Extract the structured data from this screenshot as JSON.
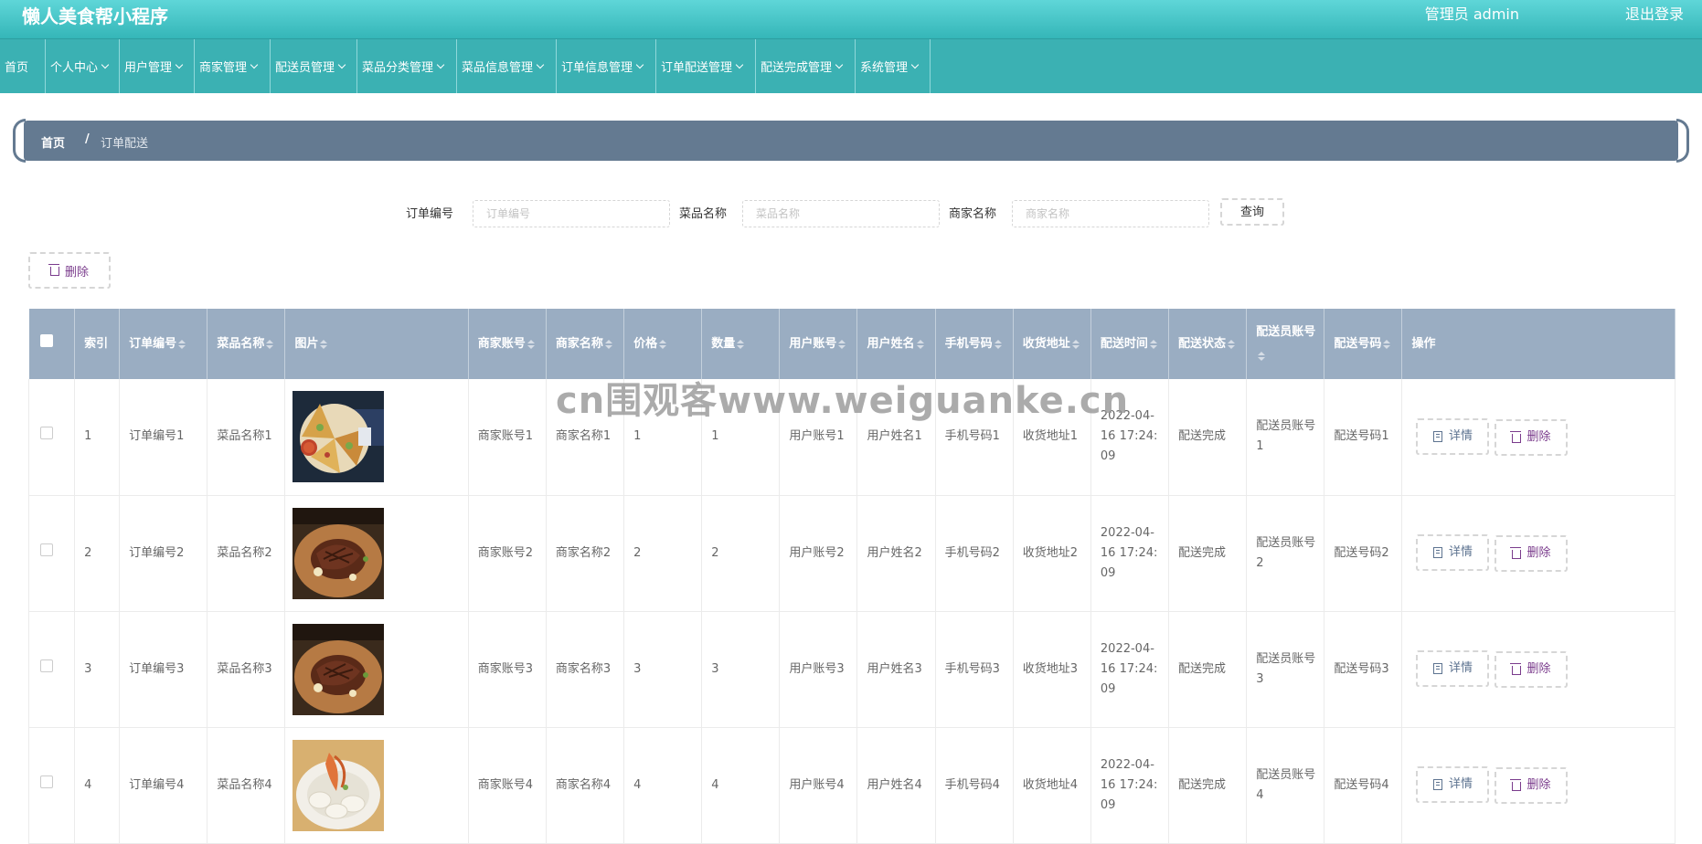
{
  "header": {
    "title": "懒人美食帮小程序",
    "admin": "管理员 admin",
    "logout": "退出登录"
  },
  "nav": [
    {
      "label": "首页",
      "dropdown": false
    },
    {
      "label": "个人中心",
      "dropdown": true
    },
    {
      "label": "用户管理",
      "dropdown": true
    },
    {
      "label": "商家管理",
      "dropdown": true
    },
    {
      "label": "配送员管理",
      "dropdown": true
    },
    {
      "label": "菜品分类管理",
      "dropdown": true
    },
    {
      "label": "菜品信息管理",
      "dropdown": true
    },
    {
      "label": "订单信息管理",
      "dropdown": true
    },
    {
      "label": "订单配送管理",
      "dropdown": true
    },
    {
      "label": "配送完成管理",
      "dropdown": true
    },
    {
      "label": "系统管理",
      "dropdown": true
    }
  ],
  "breadcrumb": {
    "home": "首页",
    "separator": "/",
    "current": "订单配送"
  },
  "search": {
    "order_label": "订单编号",
    "order_placeholder": "订单编号",
    "dish_label": "菜品名称",
    "dish_placeholder": "菜品名称",
    "merchant_label": "商家名称",
    "merchant_placeholder": "商家名称",
    "query_button": "查询"
  },
  "toolbar": {
    "delete_label": "删除"
  },
  "table": {
    "columns": [
      "索引",
      "订单编号",
      "菜品名称",
      "图片",
      "商家账号",
      "商家名称",
      "价格",
      "数量",
      "用户账号",
      "用户姓名",
      "手机号码",
      "收货地址",
      "配送时间",
      "配送状态",
      "配送员账号",
      "配送号码",
      "操作"
    ],
    "rows": [
      {
        "index": "1",
        "order_no": "订单编号1",
        "dish_name": "菜品名称1",
        "image": "food-pizza-image",
        "merchant_account": "商家账号1",
        "merchant_name": "商家名称1",
        "price": "1",
        "quantity": "1",
        "user_account": "用户账号1",
        "user_name": "用户姓名1",
        "phone": "手机号码1",
        "address": "收货地址1",
        "time": "2022-04-16 17:24:09",
        "status": "配送完成",
        "courier_account": "配送员账号1",
        "courier_no": "配送号码1"
      },
      {
        "index": "2",
        "order_no": "订单编号2",
        "dish_name": "菜品名称2",
        "image": "food-steak-image",
        "merchant_account": "商家账号2",
        "merchant_name": "商家名称2",
        "price": "2",
        "quantity": "2",
        "user_account": "用户账号2",
        "user_name": "用户姓名2",
        "phone": "手机号码2",
        "address": "收货地址2",
        "time": "2022-04-16 17:24:09",
        "status": "配送完成",
        "courier_account": "配送员账号2",
        "courier_no": "配送号码2"
      },
      {
        "index": "3",
        "order_no": "订单编号3",
        "dish_name": "菜品名称3",
        "image": "food-steak-image",
        "merchant_account": "商家账号3",
        "merchant_name": "商家名称3",
        "price": "3",
        "quantity": "3",
        "user_account": "用户账号3",
        "user_name": "用户姓名3",
        "phone": "手机号码3",
        "address": "收货地址3",
        "time": "2022-04-16 17:24:09",
        "status": "配送完成",
        "courier_account": "配送员账号3",
        "courier_no": "配送号码3"
      },
      {
        "index": "4",
        "order_no": "订单编号4",
        "dish_name": "菜品名称4",
        "image": "food-shrimp-image",
        "merchant_account": "商家账号4",
        "merchant_name": "商家名称4",
        "price": "4",
        "quantity": "4",
        "user_account": "用户账号4",
        "user_name": "用户姓名4",
        "phone": "手机号码4",
        "address": "收货地址4",
        "time": "2022-04-16 17:24:09",
        "status": "配送完成",
        "courier_account": "配送员账号4",
        "courier_no": "配送号码4"
      }
    ],
    "actions": {
      "detail": "详情",
      "delete": "删除"
    }
  },
  "watermark": "cn围观客www.weiguanke.cn",
  "colors": {
    "header": "#3bb1b3",
    "breadcrumb": "#647a91",
    "table_header": "#9aadc2",
    "delete_accent": "#7a3b8c",
    "detail_accent": "#5d7390"
  }
}
